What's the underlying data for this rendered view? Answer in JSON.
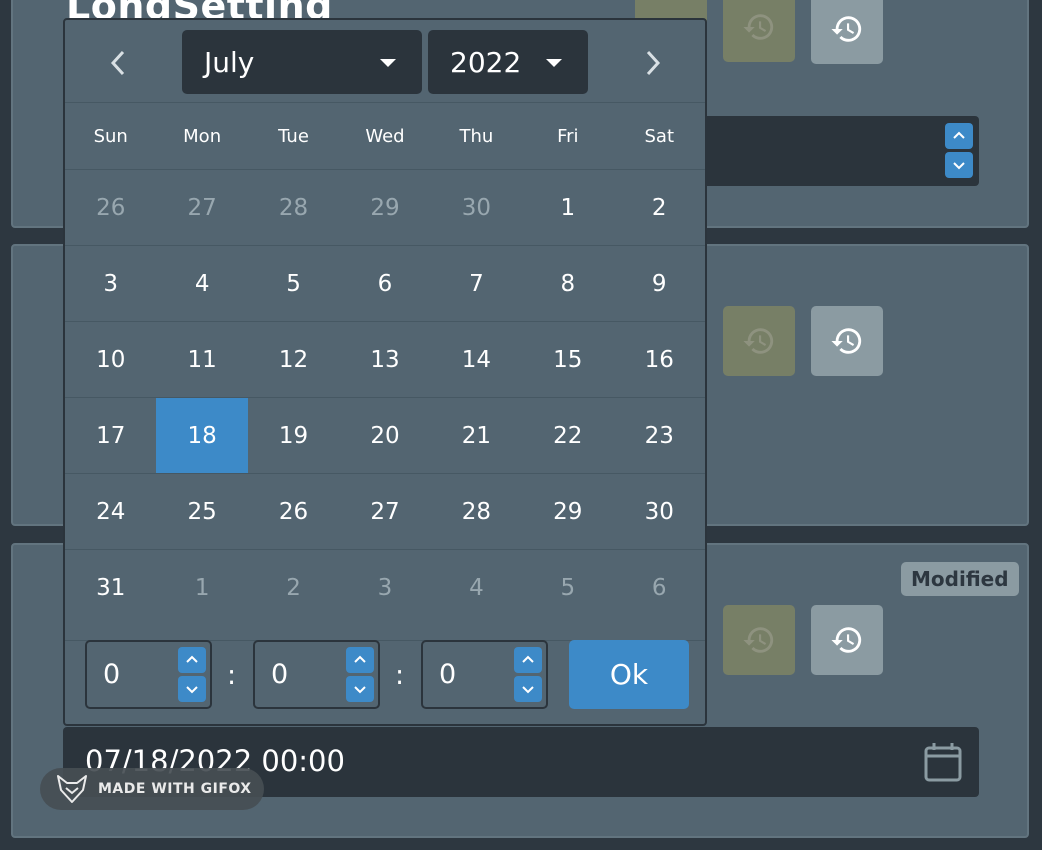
{
  "settings": {
    "first_title": "LongSetting",
    "modified_badge": "Modified",
    "date_value": "07/18/2022 00:00"
  },
  "watermark": {
    "text": "MADE WITH GIFOX"
  },
  "calendar": {
    "month": "July",
    "year": "2022",
    "weekdays": [
      "Sun",
      "Mon",
      "Tue",
      "Wed",
      "Thu",
      "Fri",
      "Sat"
    ],
    "weeks": [
      [
        {
          "d": "26",
          "m": true
        },
        {
          "d": "27",
          "m": true
        },
        {
          "d": "28",
          "m": true
        },
        {
          "d": "29",
          "m": true
        },
        {
          "d": "30",
          "m": true
        },
        {
          "d": "1"
        },
        {
          "d": "2"
        }
      ],
      [
        {
          "d": "3"
        },
        {
          "d": "4"
        },
        {
          "d": "5"
        },
        {
          "d": "6"
        },
        {
          "d": "7"
        },
        {
          "d": "8"
        },
        {
          "d": "9"
        }
      ],
      [
        {
          "d": "10"
        },
        {
          "d": "11"
        },
        {
          "d": "12"
        },
        {
          "d": "13"
        },
        {
          "d": "14"
        },
        {
          "d": "15"
        },
        {
          "d": "16"
        }
      ],
      [
        {
          "d": "17"
        },
        {
          "d": "18",
          "sel": true
        },
        {
          "d": "19"
        },
        {
          "d": "20"
        },
        {
          "d": "21"
        },
        {
          "d": "22"
        },
        {
          "d": "23"
        }
      ],
      [
        {
          "d": "24"
        },
        {
          "d": "25"
        },
        {
          "d": "26"
        },
        {
          "d": "27"
        },
        {
          "d": "28"
        },
        {
          "d": "29"
        },
        {
          "d": "30"
        }
      ],
      [
        {
          "d": "31"
        },
        {
          "d": "1",
          "m": true
        },
        {
          "d": "2",
          "m": true
        },
        {
          "d": "3",
          "m": true
        },
        {
          "d": "4",
          "m": true
        },
        {
          "d": "5",
          "m": true
        },
        {
          "d": "6",
          "m": true
        }
      ]
    ],
    "time": {
      "hours": "0",
      "minutes": "0",
      "seconds": "0",
      "separator": ":"
    },
    "ok_label": "Ok"
  },
  "colors": {
    "panel": "#536571",
    "input_dark": "#2b343c",
    "accent_blue": "#3d8ac8",
    "reset_disabled": "#777f66",
    "history_button": "#8b9ba2"
  },
  "icons": [
    "history-icon",
    "calendar-icon",
    "chevron-left-icon",
    "chevron-right-icon",
    "caret-down-icon",
    "chevron-up-icon",
    "chevron-down-icon",
    "fox-logo-icon"
  ]
}
